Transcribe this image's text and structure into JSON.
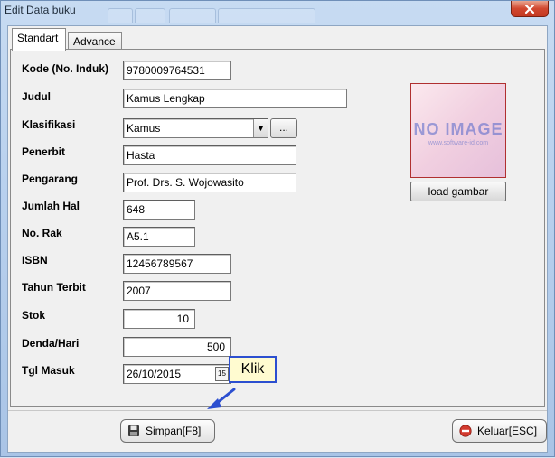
{
  "window": {
    "title": "Edit Data buku"
  },
  "tabs": [
    "Standart",
    "Advance"
  ],
  "form": {
    "kode_label": "Kode (No. Induk)",
    "kode_value": "9780009764531",
    "judul_label": "Judul",
    "judul_value": "Kamus Lengkap",
    "klasifikasi_label": "Klasifikasi",
    "klasifikasi_value": "Kamus",
    "klasifikasi_browse": "...",
    "penerbit_label": "Penerbit",
    "penerbit_value": "Hasta",
    "pengarang_label": "Pengarang",
    "pengarang_value": "Prof. Drs. S. Wojowasito",
    "jumlah_hal_label": "Jumlah Hal",
    "jumlah_hal_value": "648",
    "no_rak_label": "No. Rak",
    "no_rak_value": "A5.1",
    "isbn_label": "ISBN",
    "isbn_value": "12456789567",
    "tahun_label": "Tahun Terbit",
    "tahun_value": "2007",
    "stok_label": "Stok",
    "stok_value": "10",
    "denda_label": "Denda/Hari",
    "denda_value": "500",
    "tgl_label": "Tgl Masuk",
    "tgl_value": "26/10/2015",
    "calendar_glyph": "15"
  },
  "image": {
    "placeholder_mark": "NO IMAGE",
    "placeholder_sub": "www.software-id.com",
    "load_label": "load gambar"
  },
  "buttons": {
    "save_label": "Simpan[F8]",
    "exit_label": "Keluar[ESC]"
  },
  "annotation": {
    "callout_text": "Klik",
    "callout_color": "#2c4fd0"
  }
}
